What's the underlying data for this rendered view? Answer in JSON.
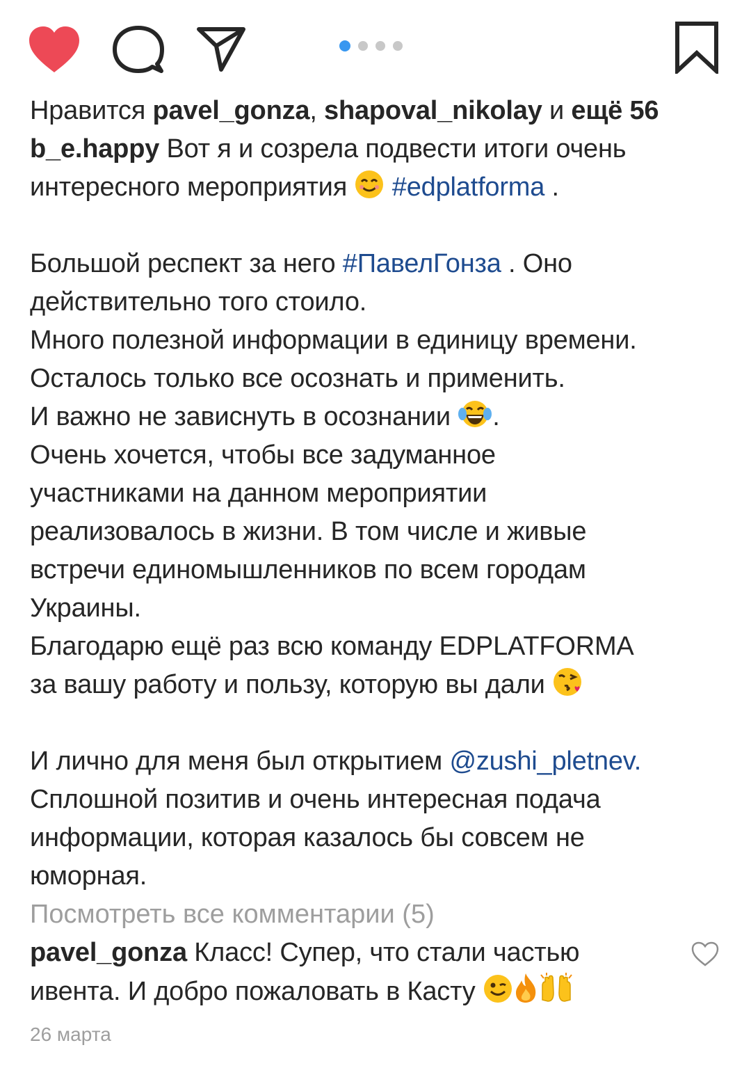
{
  "actions": {
    "like_icon": "heart-filled-icon",
    "comment_icon": "comment-bubble-icon",
    "share_icon": "paper-plane-icon",
    "save_icon": "bookmark-icon",
    "like_color": "#ed4956",
    "carousel": {
      "total": 4,
      "active": 1,
      "active_color": "#3897f0"
    }
  },
  "likes": {
    "prefix": "Нравится ",
    "user1": "pavel_gonza",
    "sep": ", ",
    "user2": "shapoval_nikolay",
    "and": " и ",
    "more": "ещё 56"
  },
  "caption": {
    "author": "b_e.happy",
    "l1_text": " Вот я и созрела подвести итоги очень",
    "l2_text": "интересного мероприятия ",
    "l2_tag": "#edplatforma",
    "l2_end": " .",
    "l3_text": "Большой респект за него ",
    "l3_tag": "#ПавелГонза",
    "l3_end": " . Оно",
    "l4": "действительно того стоило.",
    "l5": "Много полезной информации в единицу времени.",
    "l6": "Осталось только все осознать и применить.",
    "l7_text": "И важно не зависнуть в осознании ",
    "l7_end": ".",
    "l8": "Очень хочется, чтобы все задуманное",
    "l9": "участниками на данном мероприятии",
    "l10": "реализовалось в жизни. В том числе и живые",
    "l11": "встречи единомышленников по всем городам",
    "l12": "Украины.",
    "l13": "Благодарю ещё раз всю команду EDPLATFORMA",
    "l14_text": "за вашу работу и пользу, которую вы дали ",
    "l15_text": "И лично для меня был открытием ",
    "l15_mention": "@zushi_pletnev.",
    "l16": "Сплошной позитив и очень интересная подача",
    "l17": "информации, которая казалось бы совсем не",
    "l18": "юморная."
  },
  "comments": {
    "view_all": "Посмотреть все комментарии (5)",
    "author": "pavel_gonza",
    "text1": " Класс! Супер, что стали частью",
    "text2": "ивента. И добро пожаловать в Касту "
  },
  "date": "26 марта",
  "colors": {
    "text": "#262626",
    "hashtag": "#1e4b8f",
    "muted": "#9e9e9e"
  }
}
